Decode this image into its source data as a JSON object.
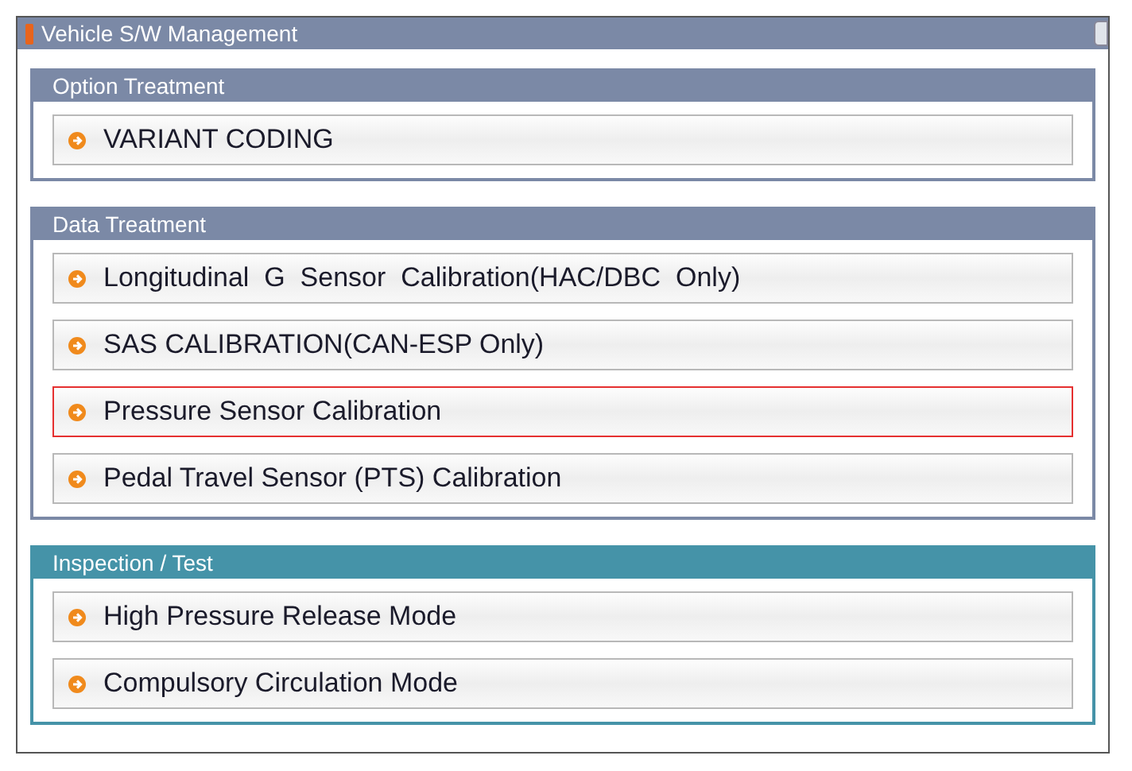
{
  "window": {
    "title": "Vehicle S/W Management"
  },
  "sections": [
    {
      "title": "Option Treatment",
      "color": "#7b89a6",
      "items": [
        {
          "label": "VARIANT CODING",
          "selected": false
        }
      ]
    },
    {
      "title": "Data Treatment",
      "color": "#7b89a6",
      "items": [
        {
          "label": "Longitudinal  G  Sensor  Calibration(HAC/DBC  Only)",
          "selected": false
        },
        {
          "label": "SAS CALIBRATION(CAN-ESP Only)",
          "selected": false
        },
        {
          "label": "Pressure Sensor Calibration",
          "selected": true
        },
        {
          "label": "Pedal Travel Sensor (PTS) Calibration",
          "selected": false
        }
      ]
    },
    {
      "title": "Inspection / Test",
      "color": "#4593a8",
      "items": [
        {
          "label": "High Pressure Release Mode",
          "selected": false
        },
        {
          "label": "Compulsory Circulation Mode",
          "selected": false
        }
      ]
    }
  ]
}
